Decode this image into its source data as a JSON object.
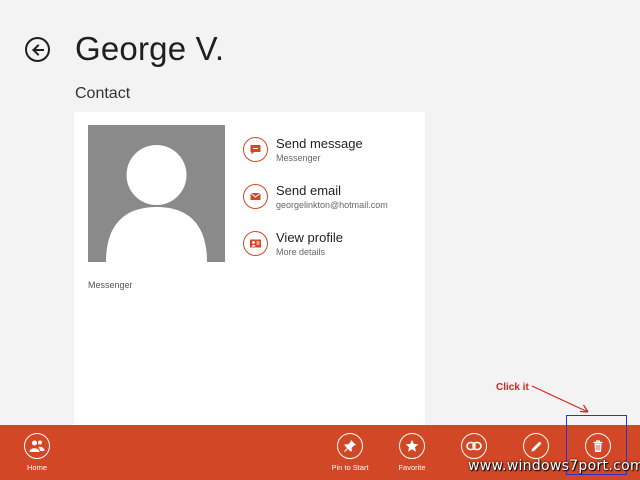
{
  "header": {
    "title": "George V.",
    "subtitle": "Contact"
  },
  "card": {
    "avatar_caption": "Messenger",
    "actions": [
      {
        "icon": "chat-icon",
        "label": "Send message",
        "sub": "Messenger"
      },
      {
        "icon": "mail-icon",
        "label": "Send email",
        "sub": "georgelinkton@hotmail.com"
      },
      {
        "icon": "profile-icon",
        "label": "View profile",
        "sub": "More details"
      }
    ]
  },
  "annotation": {
    "text": "Click it"
  },
  "appbar": {
    "items": [
      {
        "icon": "people-icon",
        "label": "Home"
      },
      {
        "icon": "pin-icon",
        "label": "Pin to Start"
      },
      {
        "icon": "star-icon",
        "label": "Favorite"
      },
      {
        "icon": "link-icon",
        "label": ""
      },
      {
        "icon": "edit-icon",
        "label": ""
      },
      {
        "icon": "trash-icon",
        "label": ""
      }
    ]
  },
  "watermark": "www.windows7port.com",
  "colors": {
    "accent": "#d24726",
    "background": "#f3f3f3",
    "annotation": "#d8221b",
    "highlight": "#2d35c9"
  }
}
